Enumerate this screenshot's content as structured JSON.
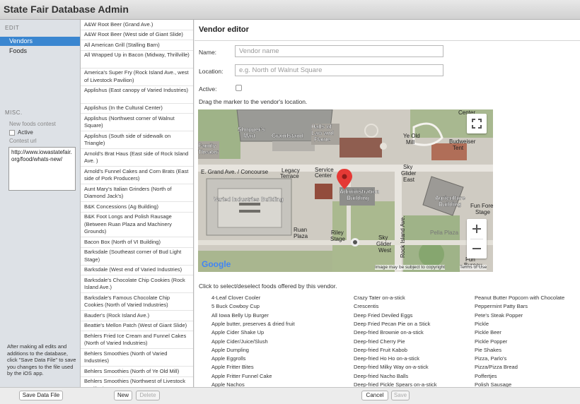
{
  "window": {
    "title": "State Fair Database Admin"
  },
  "sidebar": {
    "edit_header": "EDIT",
    "items": [
      {
        "label": "Vendors",
        "selected": true
      },
      {
        "label": "Foods",
        "selected": false
      }
    ],
    "misc_header": "MISC.",
    "new_foods_label": "New foods contest",
    "active_label": "Active",
    "contest_url_label": "Contest url",
    "contest_url_value": "http://www.iowastatefair.org/food/whats-new/",
    "note": "After making all edits and additions to the database, click \"Save Data File\" to save you changes to the file used by the iOS app."
  },
  "vendor_list": [
    "A&W Root Beer (Grand Ave.)",
    "A&W Root Beer (West side of Giant Slide)",
    "All American Grill (Stalling Barn)",
    "All Wrapped Up in Bacon (Midway, Thrillville)",
    "America's Super Fry (Rock Island Ave., west of Livestock Pavilion)",
    "Applishus (East canopy of Varied Industries)",
    "Applishus (In the Cultural Center)",
    "Applishus (Northwest corner of Walnut Square)",
    "Applishus (South side of sidewalk on Triangle)",
    "Arnold's Brat Haus (East side of Rock Island Ave. )",
    "Arnold's Funnel Cakes and Corn Brats (East side of Pork Producers)",
    "Aunt Mary's Italian Grinders (North of Diamond Jack's)",
    "B&K Concessions (Ag Building)",
    "B&K Foot Longs and Polish Rausage (Between Ruan Plaza and Machinery Grounds)",
    "Bacon Box (North of VI Building)",
    "Barksdale (Southeast corner of Bud Light Stage)",
    "Barksdale (West end of Varied Industries)",
    "Barksdale's Chocolate Chip Cookies (Rock Island Ave.)",
    "Barksdale's Famous Chocolate Chip Cookies (North of Varied Industries)",
    "Bauder's (Rock Island Ave.)",
    "Beattie's Mellon Patch (West of Giant Slide)",
    "Behlers Fried Ice Cream and Funnel Cakes (North of Varied Industries)",
    "Behlers Smoothies (North of Varied Industries)",
    "Behlers Smoothies (North of Ye Old Mill)",
    "Behlers Smoothies (Northwest of Livestock Pavilion)"
  ],
  "editor": {
    "title": "Vendor editor",
    "name_label": "Name:",
    "name_placeholder": "Vendor name",
    "location_label": "Location:",
    "location_placeholder": "e.g. North of Walnut Square",
    "active_label": "Active:",
    "map_instruction": "Drag the marker to the vendor's location.",
    "foods_instruction": "Click to select/deselect foods offered by this vendor."
  },
  "map": {
    "labels": [
      "Shopper's Mart",
      "Grandstand",
      "Halls of Law and Flame",
      "Ye Old Mill",
      "Budweiser Tent",
      "Center",
      "Family Theater",
      "E. Grand Ave. / Concourse",
      "Legacy Terrace",
      "Service Center",
      "Sky Glider East",
      "Administration Building",
      "Varied Industries Building",
      "Agriculture Building",
      "Fun Forest Stage",
      "Ruan Plaza",
      "Riley Stage",
      "Sky Glider West",
      "Rock Island Ave.",
      "Pella Plaza",
      "Fun Bureau Stage"
    ],
    "attribution": "Image may be subject to copyright",
    "terms": "Terms of Use",
    "logo": "Google"
  },
  "foods": {
    "col1": [
      "4-Leaf Clover Cooler",
      "5 Buck Cowboy Cup",
      "All Iowa Belly Up Burger",
      "Apple butter, preserves & dried fruit",
      "Apple Cider Shake Up",
      "Apple Cider/Juice/Slush",
      "Apple Dumpling",
      "Apple Eggrolls",
      "Apple Fritter Bites",
      "Apple Fritter Funnel Cake",
      "Apple Nachos"
    ],
    "col2": [
      "Crazy Tater on-a-stick",
      "Crescentis",
      "Deep Fried Deviled Eggs",
      "Deep Fried Pecan Pie on a Stick",
      "Deep-fried Brownie on-a-stick",
      "Deep-fried Cherry Pie",
      "Deep-fried Fruit Kabob",
      "Deep-fried Ho Ho on-a-stick",
      "Deep-fried Milky Way on-a-stick",
      "Deep-fried Nacho Balls",
      "Deep-fried Pickle Spears on-a-stick"
    ],
    "col3": [
      "Peanut Butter Popcorn with Chocolate",
      "Peppermint Patty Bars",
      "Pete's Steak Popper",
      "Pickle",
      "Pickle Beer",
      "Pickle Popper",
      "Pie Shakes",
      "Pizza, Parlo's",
      "Pizza/Pizza Bread",
      "Poffertjes",
      "Polish Sausage"
    ]
  },
  "buttons": {
    "save_data_file": "Save Data File",
    "new": "New",
    "delete": "Delete",
    "cancel": "Cancel",
    "save": "Save"
  },
  "colors": {
    "selection": "#3a86d0",
    "marker": "#e53935"
  }
}
